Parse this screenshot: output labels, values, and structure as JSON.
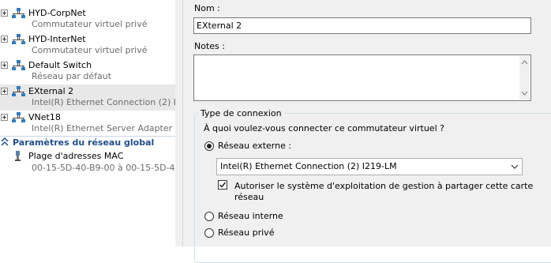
{
  "tree": {
    "items": [
      {
        "name": "HYD-CorpNet",
        "subtitle": "Commutateur virtuel privé",
        "icon": "network-switch-icon",
        "selected": false
      },
      {
        "name": "HYD-InterNet",
        "subtitle": "Commutateur virtuel privé",
        "icon": "network-switch-icon",
        "selected": false
      },
      {
        "name": "Default Switch",
        "subtitle": "Réseau par défaut",
        "icon": "network-switch-icon",
        "selected": false
      },
      {
        "name": "EXternal 2",
        "subtitle": "Intel(R) Ethernet Connection (2) I...",
        "icon": "network-switch-icon",
        "selected": true
      },
      {
        "name": "VNet18",
        "subtitle": "Intel(R) Ethernet Server Adapter I...",
        "icon": "network-switch-icon",
        "selected": false
      }
    ],
    "global_section": {
      "label": "Paramètres du réseau global",
      "icon": "chevron-up-icon",
      "items": [
        {
          "name": "Plage d'adresses MAC",
          "subtitle": "00-15-5D-40-B9-00 à 00-15-5D-40...",
          "icon": "mac-address-icon"
        }
      ]
    }
  },
  "details": {
    "name_label": "Nom :",
    "name_value": "EXternal 2",
    "notes_label": "Notes :",
    "notes_value": "",
    "connection_group": {
      "legend": "Type de connexion",
      "question": "À quoi voulez-vous connecter ce commutateur virtuel ?",
      "external_label": "Réseau externe :",
      "external_checked": true,
      "adapter_selected": "Intel(R) Ethernet Connection (2) I219-LM",
      "allow_management_label_line1": "Autoriser le système d'exploitation de gestion à partager cette carte",
      "allow_management_label_line2": "réseau",
      "allow_management_checked": true,
      "internal_label": "Réseau interne",
      "private_label": "Réseau privé"
    }
  },
  "colors": {
    "accent": "#1f4e8c",
    "selection": "#e8e8e8",
    "panel": "#f0f0f0"
  }
}
